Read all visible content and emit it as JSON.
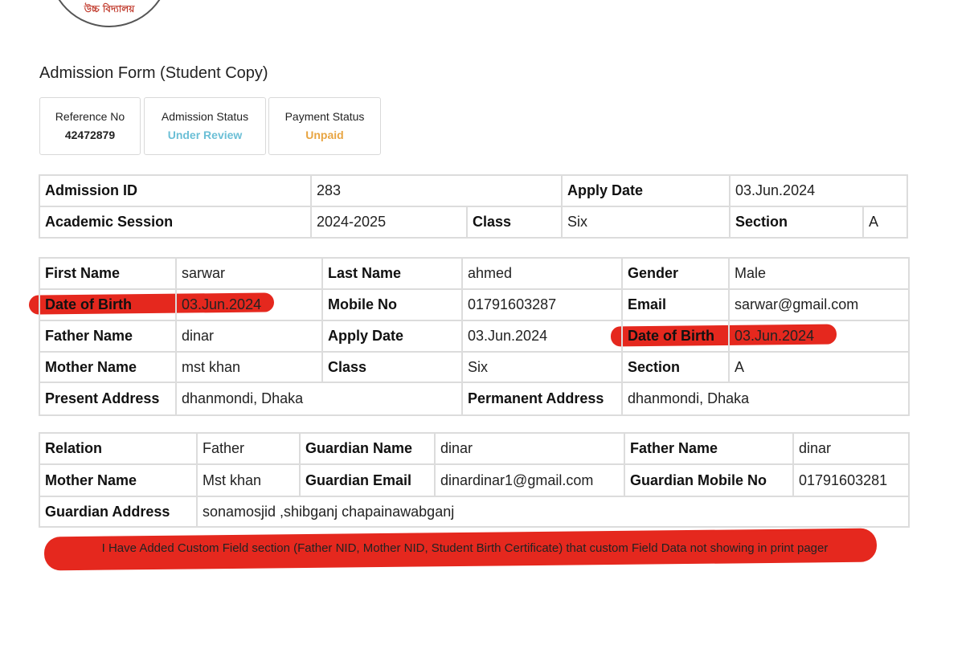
{
  "logo": {
    "text": "উচ্চ বিদ্যালয়"
  },
  "page_title": "Admission Form (Student Copy)",
  "status_cards": {
    "reference": {
      "label": "Reference No",
      "value": "42472879"
    },
    "admission": {
      "label": "Admission Status",
      "value": "Under Review",
      "color": "#6bbfd6"
    },
    "payment": {
      "label": "Payment Status",
      "value": "Unpaid",
      "color": "#e8a542"
    }
  },
  "admission_table": {
    "admission_id_label": "Admission ID",
    "admission_id": "283",
    "apply_date_label": "Apply Date",
    "apply_date": "03.Jun.2024",
    "session_label": "Academic Session",
    "session": "2024-2025",
    "class_label": "Class",
    "class": "Six",
    "section_label": "Section",
    "section": "A"
  },
  "student_table": {
    "first_name_label": "First Name",
    "first_name": "sarwar",
    "last_name_label": "Last Name",
    "last_name": "ahmed",
    "gender_label": "Gender",
    "gender": "Male",
    "dob_label": "Date of Birth",
    "dob": "03.Jun.2024",
    "mobile_label": "Mobile No",
    "mobile": "01791603287",
    "email_label": "Email",
    "email": "sarwar@gmail.com",
    "father_label": "Father Name",
    "father": "dinar",
    "apply_date_label": "Apply Date",
    "apply_date": "03.Jun.2024",
    "dob2_label": "Date of Birth",
    "dob2": "03.Jun.2024",
    "mother_label": "Mother Name",
    "mother": "mst khan",
    "class_label": "Class",
    "class": "Six",
    "section_label": "Section",
    "section": "A",
    "present_label": "Present Address",
    "present": "dhanmondi, Dhaka",
    "permanent_label": "Permanent Address",
    "permanent": "dhanmondi, Dhaka"
  },
  "guardian_table": {
    "relation_label": "Relation",
    "relation": "Father",
    "guardian_name_label": "Guardian Name",
    "guardian_name": "dinar",
    "father_label": "Father Name",
    "father": "dinar",
    "mother_label": "Mother Name",
    "mother": "Mst khan",
    "guardian_email_label": "Guardian Email",
    "guardian_email": "dinardinar1@gmail.com",
    "guardian_mobile_label": "Guardian Mobile No",
    "guardian_mobile": "01791603281",
    "guardian_address_label": "Guardian Address",
    "guardian_address": "sonamosjid ,shibganj chapainawabganj"
  },
  "annotation_note": "I Have Added Custom Field section (Father NID, Mother NID, Student Birth Certificate) that custom Field Data not showing in print pager",
  "colors": {
    "annotation_red": "#e5281e",
    "table_border": "#dcdcdc"
  }
}
